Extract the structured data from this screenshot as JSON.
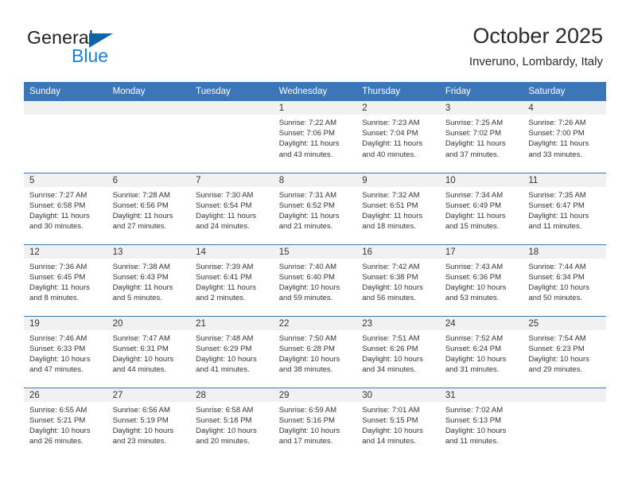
{
  "brand": {
    "name_top": "General",
    "name_bottom": "Blue",
    "triangle_color": "#1464a5",
    "blue_color": "#1a7fd4"
  },
  "header": {
    "title": "October 2025",
    "subtitle": "Inveruno, Lombardy, Italy"
  },
  "theme": {
    "header_blue": "#3a76b8",
    "daynum_band": "#f1f1f1",
    "text": "#333333"
  },
  "weekday_headers": [
    "Sunday",
    "Monday",
    "Tuesday",
    "Wednesday",
    "Thursday",
    "Friday",
    "Saturday"
  ],
  "weeks": [
    [
      {
        "day": "",
        "sunrise": "",
        "sunset": "",
        "daylight1": "",
        "daylight2": "",
        "empty": true
      },
      {
        "day": "",
        "sunrise": "",
        "sunset": "",
        "daylight1": "",
        "daylight2": "",
        "empty": true
      },
      {
        "day": "",
        "sunrise": "",
        "sunset": "",
        "daylight1": "",
        "daylight2": "",
        "empty": true
      },
      {
        "day": "1",
        "sunrise": "Sunrise: 7:22 AM",
        "sunset": "Sunset: 7:06 PM",
        "daylight1": "Daylight: 11 hours",
        "daylight2": "and 43 minutes."
      },
      {
        "day": "2",
        "sunrise": "Sunrise: 7:23 AM",
        "sunset": "Sunset: 7:04 PM",
        "daylight1": "Daylight: 11 hours",
        "daylight2": "and 40 minutes."
      },
      {
        "day": "3",
        "sunrise": "Sunrise: 7:25 AM",
        "sunset": "Sunset: 7:02 PM",
        "daylight1": "Daylight: 11 hours",
        "daylight2": "and 37 minutes."
      },
      {
        "day": "4",
        "sunrise": "Sunrise: 7:26 AM",
        "sunset": "Sunset: 7:00 PM",
        "daylight1": "Daylight: 11 hours",
        "daylight2": "and 33 minutes."
      }
    ],
    [
      {
        "day": "5",
        "sunrise": "Sunrise: 7:27 AM",
        "sunset": "Sunset: 6:58 PM",
        "daylight1": "Daylight: 11 hours",
        "daylight2": "and 30 minutes."
      },
      {
        "day": "6",
        "sunrise": "Sunrise: 7:28 AM",
        "sunset": "Sunset: 6:56 PM",
        "daylight1": "Daylight: 11 hours",
        "daylight2": "and 27 minutes."
      },
      {
        "day": "7",
        "sunrise": "Sunrise: 7:30 AM",
        "sunset": "Sunset: 6:54 PM",
        "daylight1": "Daylight: 11 hours",
        "daylight2": "and 24 minutes."
      },
      {
        "day": "8",
        "sunrise": "Sunrise: 7:31 AM",
        "sunset": "Sunset: 6:52 PM",
        "daylight1": "Daylight: 11 hours",
        "daylight2": "and 21 minutes."
      },
      {
        "day": "9",
        "sunrise": "Sunrise: 7:32 AM",
        "sunset": "Sunset: 6:51 PM",
        "daylight1": "Daylight: 11 hours",
        "daylight2": "and 18 minutes."
      },
      {
        "day": "10",
        "sunrise": "Sunrise: 7:34 AM",
        "sunset": "Sunset: 6:49 PM",
        "daylight1": "Daylight: 11 hours",
        "daylight2": "and 15 minutes."
      },
      {
        "day": "11",
        "sunrise": "Sunrise: 7:35 AM",
        "sunset": "Sunset: 6:47 PM",
        "daylight1": "Daylight: 11 hours",
        "daylight2": "and 11 minutes."
      }
    ],
    [
      {
        "day": "12",
        "sunrise": "Sunrise: 7:36 AM",
        "sunset": "Sunset: 6:45 PM",
        "daylight1": "Daylight: 11 hours",
        "daylight2": "and 8 minutes."
      },
      {
        "day": "13",
        "sunrise": "Sunrise: 7:38 AM",
        "sunset": "Sunset: 6:43 PM",
        "daylight1": "Daylight: 11 hours",
        "daylight2": "and 5 minutes."
      },
      {
        "day": "14",
        "sunrise": "Sunrise: 7:39 AM",
        "sunset": "Sunset: 6:41 PM",
        "daylight1": "Daylight: 11 hours",
        "daylight2": "and 2 minutes."
      },
      {
        "day": "15",
        "sunrise": "Sunrise: 7:40 AM",
        "sunset": "Sunset: 6:40 PM",
        "daylight1": "Daylight: 10 hours",
        "daylight2": "and 59 minutes."
      },
      {
        "day": "16",
        "sunrise": "Sunrise: 7:42 AM",
        "sunset": "Sunset: 6:38 PM",
        "daylight1": "Daylight: 10 hours",
        "daylight2": "and 56 minutes."
      },
      {
        "day": "17",
        "sunrise": "Sunrise: 7:43 AM",
        "sunset": "Sunset: 6:36 PM",
        "daylight1": "Daylight: 10 hours",
        "daylight2": "and 53 minutes."
      },
      {
        "day": "18",
        "sunrise": "Sunrise: 7:44 AM",
        "sunset": "Sunset: 6:34 PM",
        "daylight1": "Daylight: 10 hours",
        "daylight2": "and 50 minutes."
      }
    ],
    [
      {
        "day": "19",
        "sunrise": "Sunrise: 7:46 AM",
        "sunset": "Sunset: 6:33 PM",
        "daylight1": "Daylight: 10 hours",
        "daylight2": "and 47 minutes."
      },
      {
        "day": "20",
        "sunrise": "Sunrise: 7:47 AM",
        "sunset": "Sunset: 6:31 PM",
        "daylight1": "Daylight: 10 hours",
        "daylight2": "and 44 minutes."
      },
      {
        "day": "21",
        "sunrise": "Sunrise: 7:48 AM",
        "sunset": "Sunset: 6:29 PM",
        "daylight1": "Daylight: 10 hours",
        "daylight2": "and 41 minutes."
      },
      {
        "day": "22",
        "sunrise": "Sunrise: 7:50 AM",
        "sunset": "Sunset: 6:28 PM",
        "daylight1": "Daylight: 10 hours",
        "daylight2": "and 38 minutes."
      },
      {
        "day": "23",
        "sunrise": "Sunrise: 7:51 AM",
        "sunset": "Sunset: 6:26 PM",
        "daylight1": "Daylight: 10 hours",
        "daylight2": "and 34 minutes."
      },
      {
        "day": "24",
        "sunrise": "Sunrise: 7:52 AM",
        "sunset": "Sunset: 6:24 PM",
        "daylight1": "Daylight: 10 hours",
        "daylight2": "and 31 minutes."
      },
      {
        "day": "25",
        "sunrise": "Sunrise: 7:54 AM",
        "sunset": "Sunset: 6:23 PM",
        "daylight1": "Daylight: 10 hours",
        "daylight2": "and 29 minutes."
      }
    ],
    [
      {
        "day": "26",
        "sunrise": "Sunrise: 6:55 AM",
        "sunset": "Sunset: 5:21 PM",
        "daylight1": "Daylight: 10 hours",
        "daylight2": "and 26 minutes."
      },
      {
        "day": "27",
        "sunrise": "Sunrise: 6:56 AM",
        "sunset": "Sunset: 5:19 PM",
        "daylight1": "Daylight: 10 hours",
        "daylight2": "and 23 minutes."
      },
      {
        "day": "28",
        "sunrise": "Sunrise: 6:58 AM",
        "sunset": "Sunset: 5:18 PM",
        "daylight1": "Daylight: 10 hours",
        "daylight2": "and 20 minutes."
      },
      {
        "day": "29",
        "sunrise": "Sunrise: 6:59 AM",
        "sunset": "Sunset: 5:16 PM",
        "daylight1": "Daylight: 10 hours",
        "daylight2": "and 17 minutes."
      },
      {
        "day": "30",
        "sunrise": "Sunrise: 7:01 AM",
        "sunset": "Sunset: 5:15 PM",
        "daylight1": "Daylight: 10 hours",
        "daylight2": "and 14 minutes."
      },
      {
        "day": "31",
        "sunrise": "Sunrise: 7:02 AM",
        "sunset": "Sunset: 5:13 PM",
        "daylight1": "Daylight: 10 hours",
        "daylight2": "and 11 minutes."
      },
      {
        "day": "",
        "sunrise": "",
        "sunset": "",
        "daylight1": "",
        "daylight2": "",
        "empty": true
      }
    ]
  ]
}
